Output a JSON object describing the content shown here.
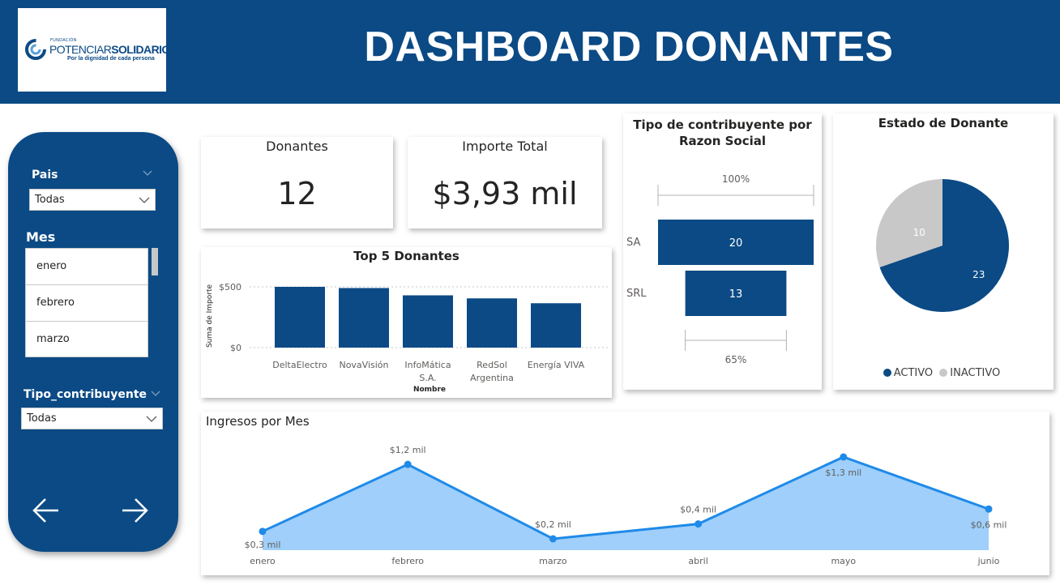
{
  "header": {
    "title": "DASHBOARD DONANTES",
    "logo": {
      "small_text": "FUNDACIÓN",
      "name_part1": "POTENCIAR",
      "name_part2": "SOLIDARIO",
      "tagline": "Por la dignidad de cada persona"
    },
    "colors": {
      "brand": "#0b4a85",
      "accent_light": "#1f8ae8"
    }
  },
  "filters": {
    "pais": {
      "label": "Pais",
      "value": "Todas"
    },
    "mes": {
      "label": "Mes",
      "items": [
        "enero",
        "febrero",
        "marzo"
      ]
    },
    "tipo": {
      "label": "Tipo_contribuyente",
      "value": "Todas"
    },
    "nav": {
      "prev_icon": "arrow-left-icon",
      "next_icon": "arrow-right-icon"
    }
  },
  "kpis": {
    "donantes": {
      "label": "Donantes",
      "value": "12"
    },
    "importe": {
      "label": "Importe Total",
      "value": "$3,93 mil"
    }
  },
  "charts": {
    "top5": {
      "title": "Top 5 Donantes",
      "xlabel": "Nombre",
      "ylabel": "Suma de Importe",
      "ticks": [
        "$500",
        "$0"
      ]
    },
    "tipo": {
      "title_line1": "Tipo de contribuyente por",
      "title_line2": "Razon Social",
      "top_pct": "100%",
      "bottom_pct": "65%"
    },
    "estado": {
      "title": "Estado de Donante"
    },
    "ingresos": {
      "title": "Ingresos por Mes"
    }
  },
  "chart_data": [
    {
      "type": "bar",
      "title": "Top 5 Donantes",
      "categories": [
        "DeltaElectro",
        "NovaVisión",
        "InfoMática S.A.",
        "RedSol Argentina",
        "Energía VIVA"
      ],
      "values": [
        500,
        490,
        430,
        405,
        365
      ],
      "xlabel": "Nombre",
      "ylabel": "Suma de Importe",
      "ylim": [
        0,
        500
      ],
      "tick_labels": [
        "$0",
        "$500"
      ],
      "grid": true
    },
    {
      "type": "bar",
      "subtype": "funnel",
      "title": "Tipo de contribuyente por Razon Social",
      "categories": [
        "SA",
        "SRL"
      ],
      "values": [
        20,
        13
      ],
      "percent_labels": [
        "100%",
        "65%"
      ]
    },
    {
      "type": "pie",
      "title": "Estado de Donante",
      "categories": [
        "ACTIVO",
        "INACTIVO"
      ],
      "values": [
        23,
        10
      ],
      "colors": [
        "#0b4a85",
        "#c8c8c8"
      ],
      "legend": "bottom-center"
    },
    {
      "type": "area",
      "title": "Ingresos por Mes",
      "categories": [
        "enero",
        "febrero",
        "marzo",
        "abril",
        "mayo",
        "junio"
      ],
      "values": [
        0.3,
        1.2,
        0.2,
        0.4,
        1.3,
        0.6
      ],
      "data_labels": [
        "$0,3 mil",
        "$1,2 mil",
        "$0,2 mil",
        "$0,4 mil",
        "$1,3 mil",
        "$0,6 mil"
      ],
      "colors": [
        "#1f8ae8",
        "#9fcffa"
      ]
    }
  ]
}
